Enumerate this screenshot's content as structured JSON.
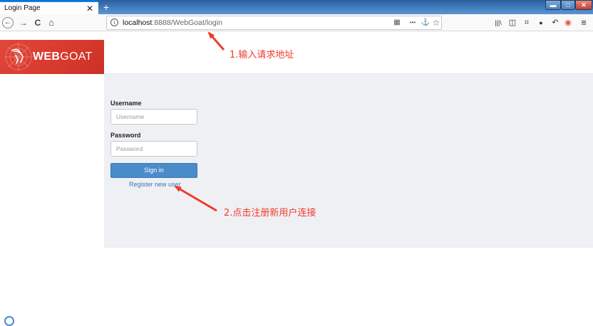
{
  "browser": {
    "tab_title": "Login Page",
    "tab_close": "✕",
    "new_tab": "+",
    "window_controls": {
      "minimize": "▬",
      "maximize": "□",
      "close": "✕"
    },
    "nav": {
      "back": "←",
      "forward": "→",
      "reload": "C",
      "home": "⌂"
    },
    "url_host": "localhost",
    "url_rest": ":8888/WebGoat/login",
    "url_actions": {
      "qr": "▦",
      "more": "•••",
      "extra": "⚓",
      "bookmark": "☆"
    },
    "toolbar_icons": {
      "library": "|||\\",
      "sidebar": "◫",
      "crop": "⌗",
      "chat": "●",
      "undo": "↶",
      "addon": "◉",
      "menu": "≡"
    }
  },
  "brand": {
    "logo_bold": "WEB",
    "logo_light": "GOAT",
    "color": "#d8392d"
  },
  "login": {
    "username_label": "Username",
    "username_placeholder": "Username",
    "password_label": "Password",
    "password_placeholder": "Password",
    "signin_label": "Sign in",
    "register_label": "Register new user"
  },
  "annotations": {
    "note1": "1.输入请求地址",
    "note2": "2.点击注册新用户连接",
    "color": "#ee3b2c"
  }
}
